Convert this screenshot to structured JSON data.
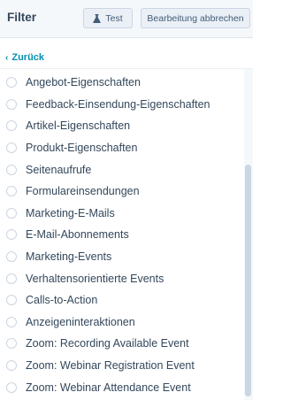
{
  "header": {
    "title": "Filter",
    "test_label": "Test",
    "cancel_label": "Bearbeitung abbrechen"
  },
  "back_label": "Zurück",
  "items": [
    "Angebot-Eigenschaften",
    "Feedback-Einsendung-Eigenschaften",
    "Artikel-Eigenschaften",
    "Produkt-Eigenschaften",
    "Seitenaufrufe",
    "Formulareinsendungen",
    "Marketing-E-Mails",
    "E-Mail-Abonnements",
    "Marketing-Events",
    "Verhaltensorientierte Events",
    "Calls-to-Action",
    "Anzeigeninteraktionen",
    "Zoom: Recording Available Event",
    "Zoom: Webinar Registration Event",
    "Zoom: Webinar Attendance Event"
  ],
  "colors": {
    "header_bg": "#f5f8fa",
    "link": "#0091ae",
    "text": "#33475b",
    "button_bg": "#eaf0f6",
    "border": "#cbd6e2"
  }
}
